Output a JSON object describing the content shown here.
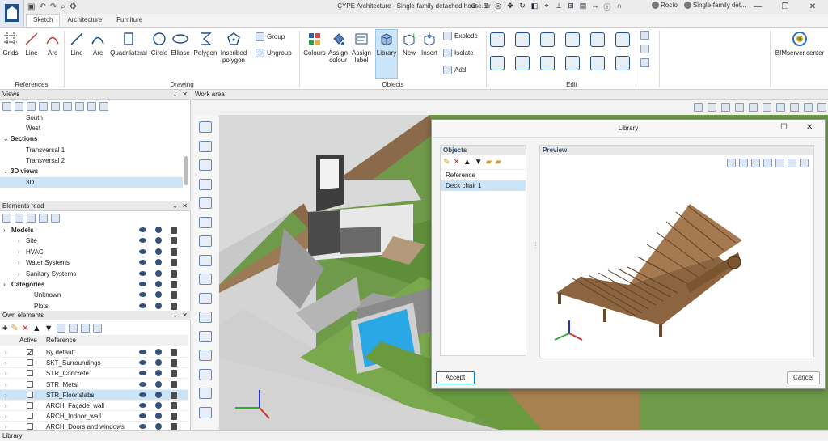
{
  "window": {
    "title": "CYPE Architecture - Single-family detached house.str",
    "user": "Rocío",
    "project": "Single-family det..."
  },
  "tabs": [
    "Sketch",
    "Architecture",
    "Furniture"
  ],
  "ribbon": {
    "references": {
      "label": "References",
      "buttons": [
        "Grids",
        "Line",
        "Arc"
      ]
    },
    "drawing": {
      "label": "Drawing",
      "buttons": [
        "Line",
        "Arc",
        "Quadrilateral",
        "Circle",
        "Ellipse",
        "Polygon",
        "Inscribed polygon"
      ],
      "group": "Group",
      "ungroup": "Ungroup"
    },
    "objects": {
      "label": "Objects",
      "buttons": [
        "Colours",
        "Assign colour",
        "Assign label",
        "Library",
        "New",
        "Insert"
      ],
      "small": [
        "Explode",
        "Isolate",
        "Add"
      ]
    },
    "edit": {
      "label": "Edit"
    },
    "bim": "BIMserver.center"
  },
  "views": {
    "title": "Views",
    "items": [
      "South",
      "West"
    ],
    "sections_label": "Sections",
    "sections": [
      "Transversal 1",
      "Transversal 2"
    ],
    "views3d_label": "3D views",
    "views3d": [
      "3D"
    ]
  },
  "elements_read": {
    "title": "Elements read",
    "models_label": "Models",
    "models": [
      "Site",
      "HVAC",
      "Water Systems",
      "Sanitary Systems"
    ],
    "categories_label": "Categories",
    "categories": [
      "Unknown",
      "Plots"
    ]
  },
  "own_elements": {
    "title": "Own elements",
    "col_active": "Active",
    "col_reference": "Reference",
    "rows": [
      {
        "ref": "By default",
        "active": true
      },
      {
        "ref": "SKT_Surroundings",
        "active": false
      },
      {
        "ref": "STR_Concrete",
        "active": false
      },
      {
        "ref": "STR_Metal",
        "active": false
      },
      {
        "ref": "STR_Floor slabs",
        "active": false
      },
      {
        "ref": "ARCH_Façade_wall",
        "active": false
      },
      {
        "ref": "ARCH_Indoor_wall",
        "active": false
      },
      {
        "ref": "ARCH_Doors and windows",
        "active": false
      }
    ]
  },
  "work_area": {
    "title": "Work area"
  },
  "library_dialog": {
    "title": "Library",
    "objects_label": "Objects",
    "preview_label": "Preview",
    "tree": [
      "Reference",
      "Deck chair 1"
    ],
    "accept": "Accept",
    "cancel": "Cancel"
  },
  "status_bar": "Library"
}
